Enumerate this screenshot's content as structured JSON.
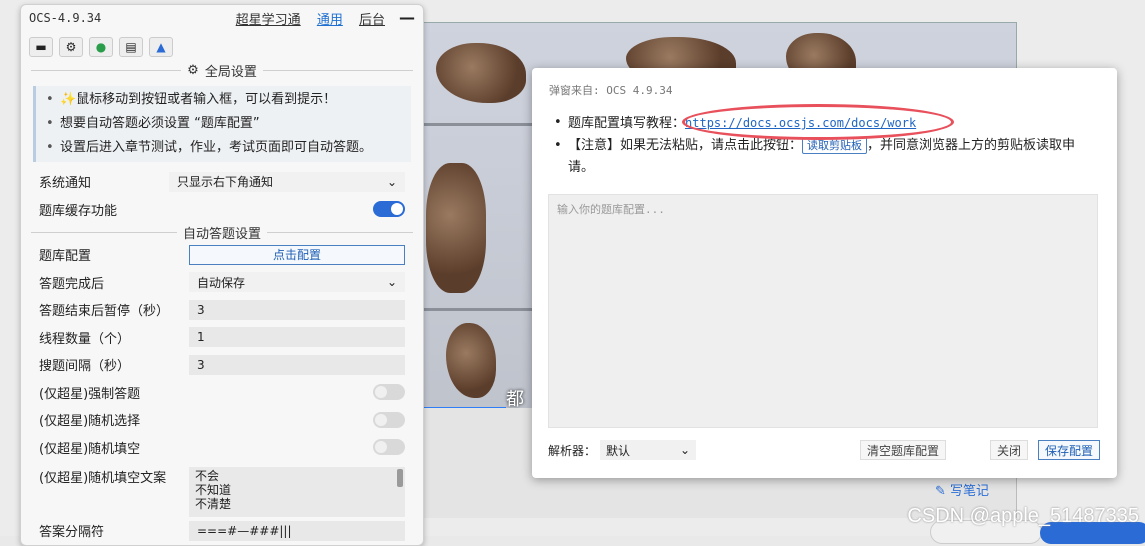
{
  "background": {
    "caption": "都",
    "note_link": "写笔记",
    "watermark": "CSDN @apple_51487335"
  },
  "panel": {
    "title": "OCS-4.9.34",
    "nav": [
      {
        "label": "超星学习通"
      },
      {
        "label": "通用"
      },
      {
        "label": "后台"
      }
    ],
    "minimize_symbol": "—",
    "tools": [
      {
        "icon": "monitor-icon",
        "glyph": "▬"
      },
      {
        "icon": "gear-icon",
        "glyph": "⚙"
      },
      {
        "icon": "globe-icon",
        "glyph": "●"
      },
      {
        "icon": "document-icon",
        "glyph": "▤"
      },
      {
        "icon": "app-icon",
        "glyph": "▲"
      }
    ],
    "global_section": "全局设置",
    "tips": [
      "✨鼠标移动到按钮或者输入框，可以看到提示！",
      "想要自动答题必须设置 “题库配置”",
      "设置后进入章节测试，作业，考试页面即可自动答题。"
    ],
    "notify_label": "系统通知",
    "notify_value": "只显示右下角通知",
    "cache_label": "题库缓存功能",
    "auto_section": "自动答题设置",
    "bank_label": "题库配置",
    "bank_button": "点击配置",
    "after_label": "答题完成后",
    "after_value": "自动保存",
    "pause_label": "答题结束后暂停（秒）",
    "pause_value": "3",
    "threads_label": "线程数量（个）",
    "threads_value": "1",
    "interval_label": "搜题间隔（秒）",
    "interval_value": "3",
    "force_label": "(仅超星)强制答题",
    "random_select_label": "(仅超星)随机选择",
    "random_fill_label": "(仅超星)随机填空",
    "random_text_label": "(仅超星)随机填空文案",
    "random_text_lines": [
      "不会",
      "不知道",
      "不清楚"
    ],
    "separator_label": "答案分隔符",
    "separator_value": "===#—###|||"
  },
  "modal": {
    "source": "弹窗来自: OCS 4.9.34",
    "tutorial_prefix": "题库配置填写教程：",
    "tutorial_link": "https://docs.ocsjs.com/docs/work",
    "notice_prefix": "【注意】如果无法粘贴，请点击此按钮：",
    "paste_button": "读取剪贴板",
    "notice_suffix": "，并同意浏览器上方的剪贴板读取申请。",
    "placeholder": "输入你的题库配置...",
    "parser_label": "解析器：",
    "parser_value": "默认",
    "clear_button": "清空题库配置",
    "close_button": "关闭",
    "save_button": "保存配置"
  }
}
